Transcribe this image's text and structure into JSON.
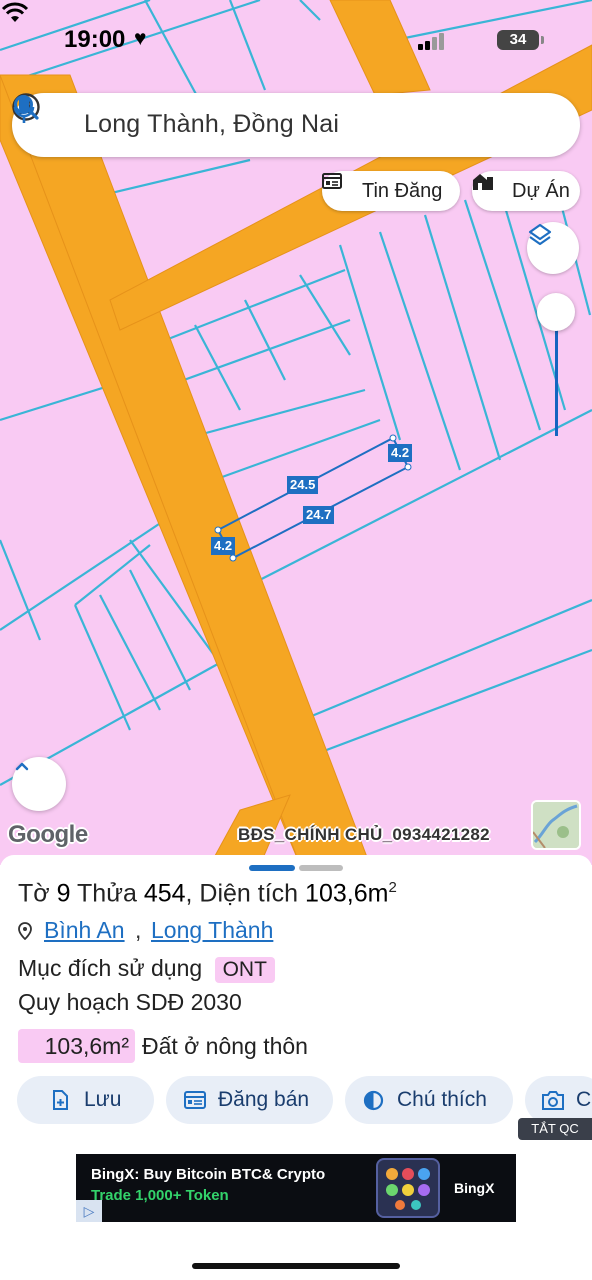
{
  "status_bar": {
    "time": "19:00",
    "battery": "34"
  },
  "search": {
    "value": "Long Thành, Đồng Nai"
  },
  "chips": {
    "news": "Tin Đăng",
    "project": "Dự Án"
  },
  "map": {
    "plot_dimensions": [
      "24.5",
      "24.7",
      "4.2",
      "4.2"
    ],
    "google_logo": "Google",
    "watermark": "BĐS_CHÍNH CHỦ_0934421282",
    "colors": {
      "land": "#f9caf3",
      "road": "#f5a623",
      "boundary": "#3ab5d6",
      "plot": "#1e6fc2"
    }
  },
  "parcel": {
    "prefix_sheet": "Tờ",
    "sheet_no": "9",
    "prefix_parcel": "Thửa",
    "parcel_no": "454",
    "prefix_area": ", Diện tích",
    "area": "103,6m",
    "area_unit_sup": "2",
    "ward": "Bình An",
    "separator": ",",
    "district": "Long Thành",
    "purpose_label": "Mục đích sử dụng",
    "purpose_code": "ONT",
    "plan_label": "Quy hoạch SDĐ 2030",
    "plan_area": "103,6m²",
    "plan_land_type": "Đất ở nông thôn"
  },
  "actions": {
    "save": "Lưu",
    "sell": "Đăng bán",
    "legend": "Chú thích",
    "photo": "C"
  },
  "ad": {
    "close_label": "TẮT QC",
    "line1": "BingX: Buy Bitcoin BTC& Crypto",
    "line2": "Trade 1,000+ Token",
    "brand": "BingX",
    "info_glyph": "▷"
  }
}
